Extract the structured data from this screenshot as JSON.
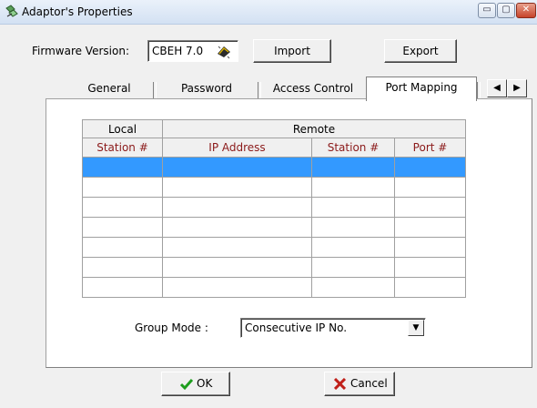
{
  "window": {
    "title": "Adaptor's Properties",
    "min_glyph": "▭",
    "max_glyph": "▢",
    "close_glyph": "✕"
  },
  "firmware": {
    "label": "Firmware Version:",
    "value": "CBEH 7.0"
  },
  "toolbar": {
    "import_label": "Import",
    "export_label": "Export"
  },
  "tabs": [
    {
      "label": "General"
    },
    {
      "label": "Password"
    },
    {
      "label": "Access Control"
    },
    {
      "label": "Port Mapping",
      "active": true
    }
  ],
  "tab_scroll": {
    "left_glyph": "◀",
    "right_glyph": "▶"
  },
  "table": {
    "group_headers": [
      "Local",
      "Remote"
    ],
    "columns": [
      "Station #",
      "IP Address",
      "Station #",
      "Port #"
    ],
    "rows": [
      [
        "",
        "",
        "",
        ""
      ],
      [
        "",
        "",
        "",
        ""
      ],
      [
        "",
        "",
        "",
        ""
      ],
      [
        "",
        "",
        "",
        ""
      ],
      [
        "",
        "",
        "",
        ""
      ],
      [
        "",
        "",
        "",
        ""
      ],
      [
        "",
        "",
        "",
        ""
      ]
    ],
    "selected_row": 0
  },
  "group_mode": {
    "label": "Group Mode :",
    "value": "Consecutive IP No.",
    "dropdown_glyph": "▼"
  },
  "buttons": {
    "ok_label": "OK",
    "cancel_label": "Cancel",
    "ok_icon": "check-icon",
    "cancel_icon": "x-icon"
  },
  "colors": {
    "selection": "#3399ff",
    "column_header_text": "#8b1a1a",
    "ok_check": "#1e9e1e",
    "cancel_x": "#c0201a"
  }
}
